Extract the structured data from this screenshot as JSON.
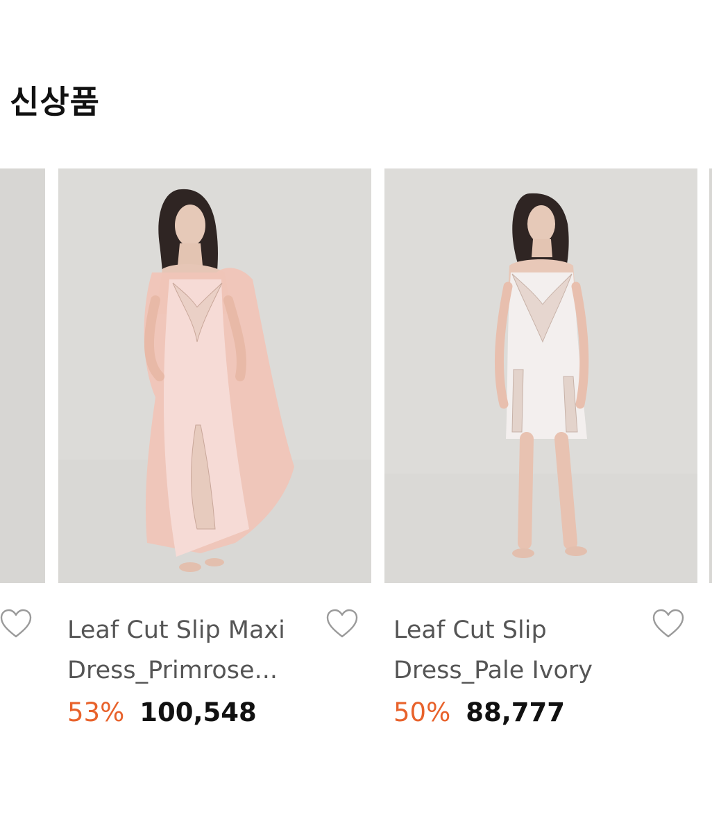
{
  "section": {
    "title": "신상품"
  },
  "products": [
    {
      "name_line1": "Leaf Cut Slip Maxi",
      "name_line2": "Dress_Primrose...",
      "discount": "53%",
      "price": "100,548",
      "wishlist_icon": "heart-outline-icon"
    },
    {
      "name_line1": "Leaf Cut Slip",
      "name_line2": "Dress_Pale Ivory",
      "discount": "50%",
      "price": "88,777",
      "wishlist_icon": "heart-outline-icon"
    }
  ],
  "colors": {
    "discount": "#e8622b",
    "price": "#111111",
    "name": "#555555",
    "photo_background": "#dcdbd8"
  }
}
